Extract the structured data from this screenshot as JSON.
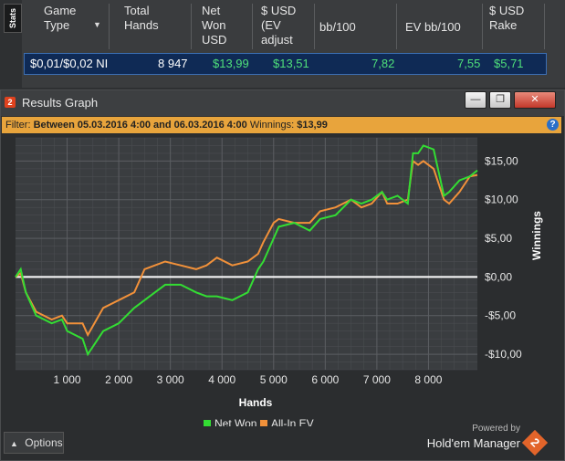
{
  "stats_tab": "Stats",
  "columns": [
    {
      "label": "Game Type",
      "sort": "▼"
    },
    {
      "label": "Total Hands"
    },
    {
      "label": "Net Won USD"
    },
    {
      "label": "$ USD (EV adjust"
    },
    {
      "label": "bb/100"
    },
    {
      "label": "EV bb/100"
    },
    {
      "label": "$ USD Rake"
    }
  ],
  "row": {
    "game_type": "$0,01/$0,02 NI",
    "total_hands": "8 947",
    "net_won": "$13,99",
    "ev_adjusted": "$13,51",
    "bb100": "7,82",
    "ev_bb100": "7,55",
    "rake": "$5,71"
  },
  "window": {
    "title": "Results Graph",
    "minimize_label": "—",
    "restore_label": "❐",
    "close_label": "✕"
  },
  "filter": {
    "prefix": "Filter:",
    "range": "Between 05.03.2016 4:00 and 06.03.2016 4:00",
    "winnings_label": "Winnings:",
    "winnings_value": "$13,99",
    "help_label": "?"
  },
  "options_label": "Options",
  "branding": {
    "powered_by": "Powered by",
    "product": "Hold'em Manager",
    "logo_text": "2"
  },
  "colors": {
    "net_won": "#33dd33",
    "all_in_ev": "#f2913a",
    "zero_line": "#ffffff"
  },
  "chart_data": {
    "type": "line",
    "xlabel": "Hands",
    "ylabel": "Winnings",
    "xlim": [
      0,
      8947
    ],
    "ylim": [
      -12,
      18
    ],
    "x_ticks": [
      1000,
      2000,
      3000,
      4000,
      5000,
      6000,
      7000,
      8000
    ],
    "x_tick_labels": [
      "1 000",
      "2 000",
      "3 000",
      "4 000",
      "5 000",
      "6 000",
      "7 000",
      "8 000"
    ],
    "y_ticks": [
      15,
      10,
      5,
      0,
      -5,
      -10
    ],
    "y_tick_labels": [
      "$15,00",
      "$10,00",
      "$5,00",
      "$0,00",
      "-$5,00",
      "-$10,00"
    ],
    "legend_position": "bottom-center",
    "grid": true,
    "series": [
      {
        "name": "Net Won",
        "x": [
          0,
          100,
          200,
          400,
          700,
          900,
          1000,
          1300,
          1400,
          1700,
          2000,
          2300,
          2500,
          2700,
          2900,
          3200,
          3500,
          3700,
          3900,
          4200,
          4500,
          4700,
          4800,
          5000,
          5100,
          5400,
          5700,
          5900,
          6200,
          6500,
          6700,
          6900,
          7100,
          7200,
          7400,
          7600,
          7700,
          7800,
          7900,
          8100,
          8300,
          8400,
          8600,
          8800,
          8947
        ],
        "y": [
          0,
          1,
          -2,
          -5,
          -6,
          -5.5,
          -7,
          -8,
          -10,
          -7,
          -6,
          -4,
          -3,
          -2,
          -1,
          -1,
          -2,
          -2.5,
          -2.5,
          -3,
          -2,
          1,
          2,
          5,
          6.5,
          7,
          6,
          7.5,
          8,
          10,
          9.5,
          10,
          11,
          10,
          10.5,
          9.5,
          16,
          16,
          17,
          16.5,
          10.5,
          11,
          12.5,
          13,
          13.8
        ]
      },
      {
        "name": "All-In EV",
        "x": [
          0,
          100,
          200,
          400,
          700,
          900,
          1000,
          1300,
          1400,
          1700,
          2000,
          2300,
          2500,
          2700,
          2900,
          3200,
          3500,
          3700,
          3900,
          4200,
          4500,
          4700,
          4800,
          5000,
          5100,
          5400,
          5700,
          5900,
          6200,
          6500,
          6700,
          6900,
          7100,
          7200,
          7400,
          7600,
          7700,
          7800,
          7900,
          8100,
          8300,
          8400,
          8600,
          8800,
          8947
        ],
        "y": [
          0,
          0.5,
          -2,
          -4.5,
          -5.5,
          -5,
          -6,
          -6,
          -7.5,
          -4,
          -3,
          -2,
          1,
          1.5,
          2,
          1.5,
          1,
          1.5,
          2.5,
          1.5,
          2,
          3,
          4.5,
          7,
          7.5,
          7,
          7,
          8.5,
          9,
          10,
          9,
          9.5,
          11,
          9.5,
          9.5,
          10,
          15,
          14.5,
          15,
          14,
          10,
          9.5,
          11,
          13,
          13.2
        ]
      }
    ]
  }
}
